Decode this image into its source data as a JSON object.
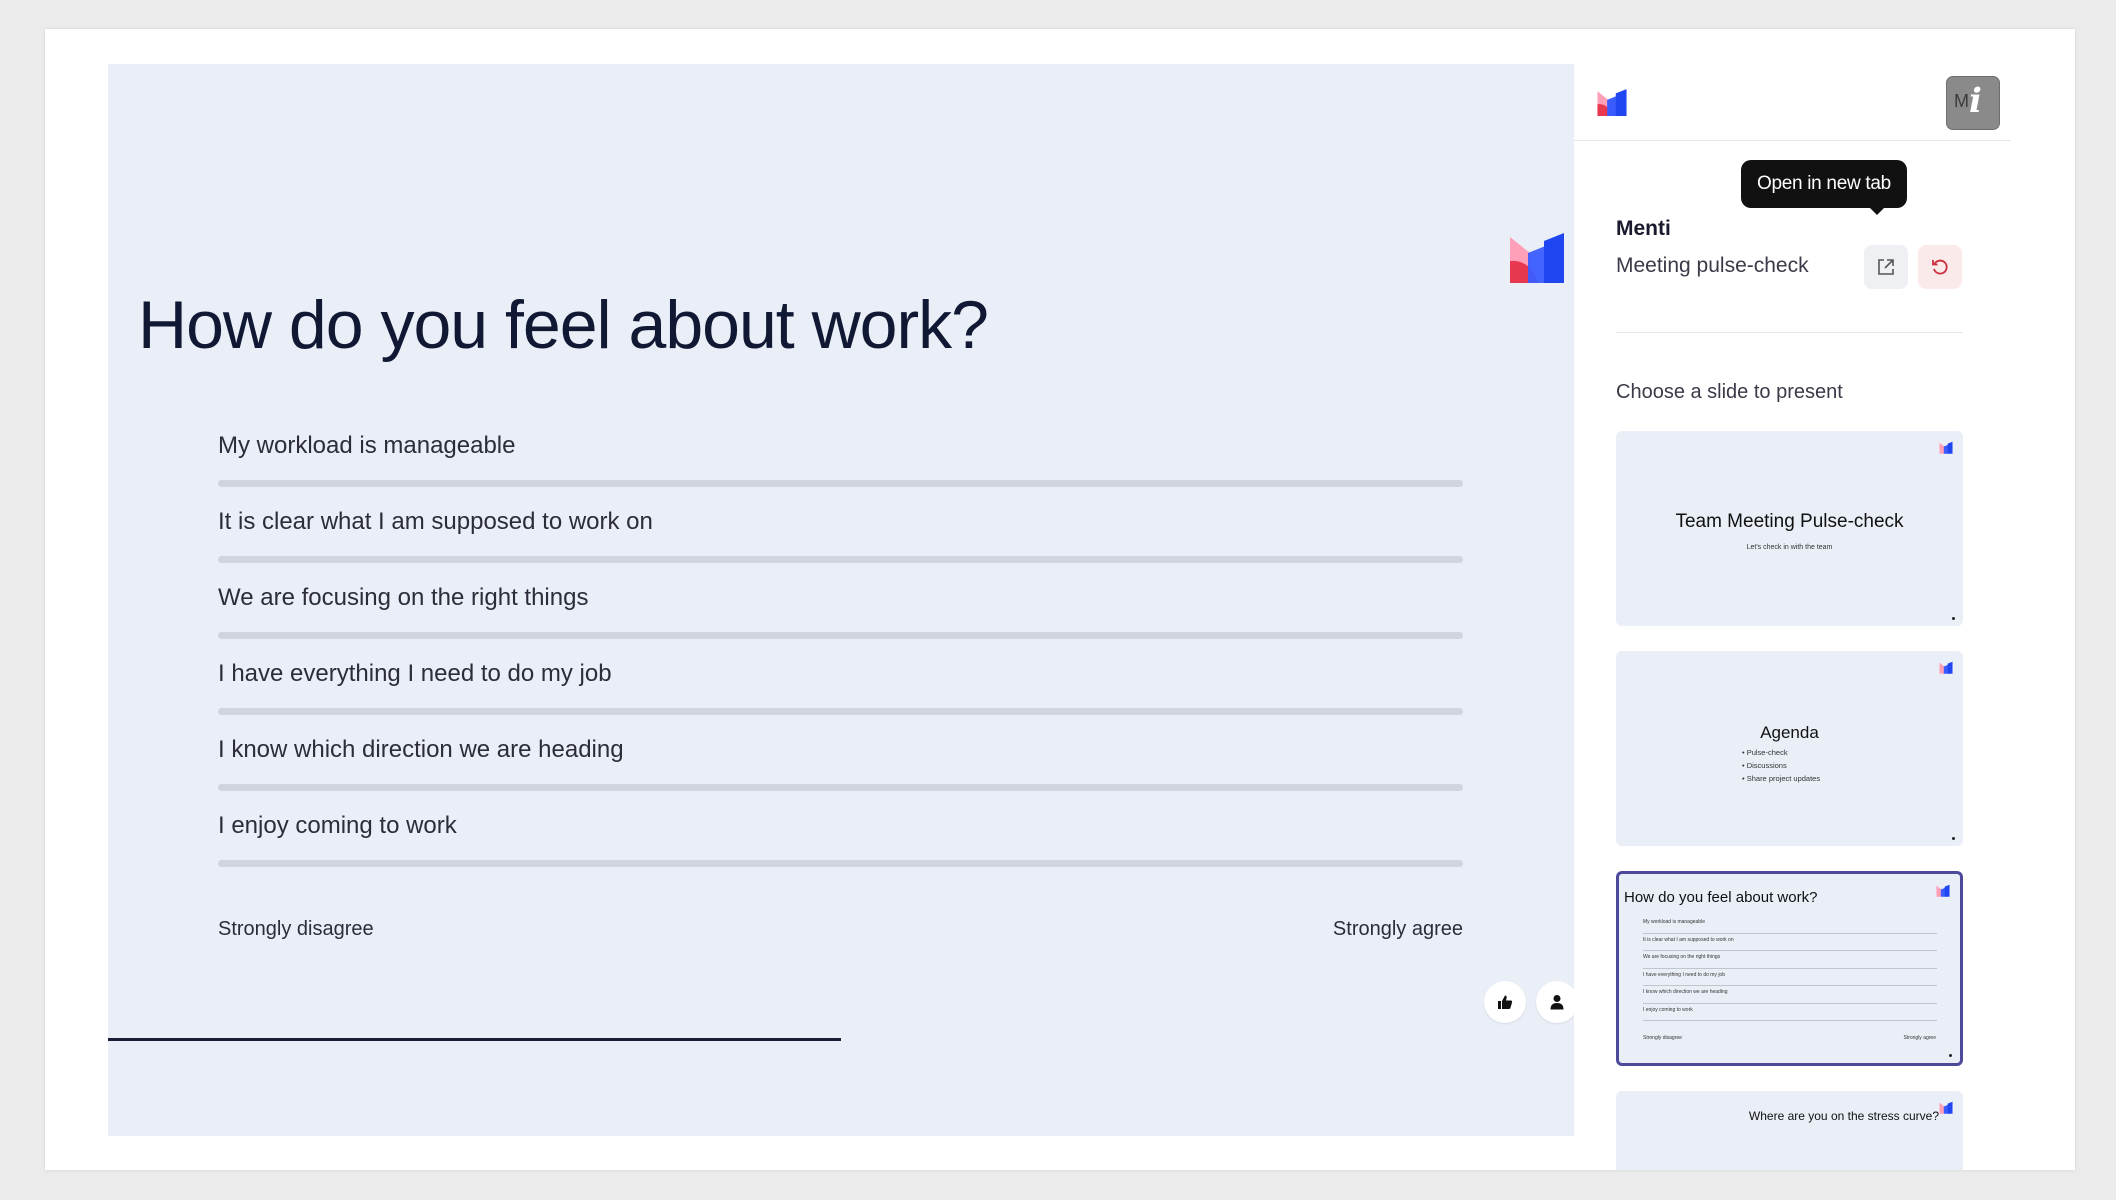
{
  "slide": {
    "title": "How do you feel about work?",
    "statements": [
      "My workload is manageable",
      "It is clear what I am supposed to work on",
      "We are focusing on the right things",
      "I have everything I need to do my job",
      "I know which direction we are heading",
      "I enjoy coming to work"
    ],
    "scale_min_label": "Strongly disagree",
    "scale_max_label": "Strongly agree",
    "progress_fraction": 0.5
  },
  "panel": {
    "avatar_initials": "M",
    "info_glyph": "i",
    "tooltip": "Open in new tab",
    "org_name": "Menti",
    "presentation_name": "Meeting pulse-check",
    "choose_label": "Choose a slide to present",
    "thumbnails": [
      {
        "title": "Team Meeting Pulse-check",
        "subtitle": "Let's check in with the team"
      },
      {
        "title": "Agenda",
        "items": [
          "Pulse-check",
          "Discussions",
          "Share project updates"
        ]
      },
      {
        "title": "How do you feel about work?",
        "statements": [
          "My workload is manageable",
          "It is clear what I am supposed to work on",
          "We are focusing on the right things",
          "I have everything I need to do my job",
          "I know which direction we are heading",
          "I enjoy coming to work"
        ],
        "scale_min_label": "Strongly disagree",
        "scale_max_label": "Strongly agree"
      },
      {
        "title": "Where are you on the stress curve?"
      }
    ]
  },
  "colors": {
    "slide_background": "#e9eef7",
    "accent_blue": "#2f5bff",
    "accent_pink": "#ff8fab",
    "accent_red": "#e8384f",
    "selected_border": "#4d4a9c"
  },
  "icons": [
    "mentimeter-logo",
    "info-icon",
    "open-in-new-tab-icon",
    "reset-icon",
    "thumbs-up-icon",
    "person-icon"
  ]
}
